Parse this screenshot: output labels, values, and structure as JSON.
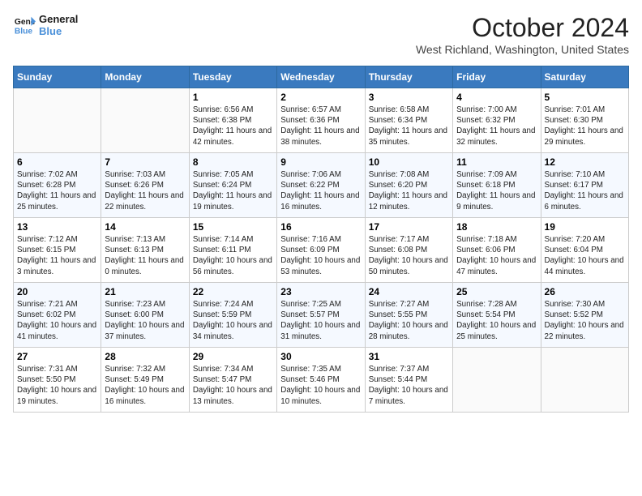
{
  "logo": {
    "line1": "General",
    "line2": "Blue"
  },
  "title": "October 2024",
  "location": "West Richland, Washington, United States",
  "weekdays": [
    "Sunday",
    "Monday",
    "Tuesday",
    "Wednesday",
    "Thursday",
    "Friday",
    "Saturday"
  ],
  "weeks": [
    [
      {
        "day": "",
        "text": ""
      },
      {
        "day": "",
        "text": ""
      },
      {
        "day": "1",
        "text": "Sunrise: 6:56 AM\nSunset: 6:38 PM\nDaylight: 11 hours and 42 minutes."
      },
      {
        "day": "2",
        "text": "Sunrise: 6:57 AM\nSunset: 6:36 PM\nDaylight: 11 hours and 38 minutes."
      },
      {
        "day": "3",
        "text": "Sunrise: 6:58 AM\nSunset: 6:34 PM\nDaylight: 11 hours and 35 minutes."
      },
      {
        "day": "4",
        "text": "Sunrise: 7:00 AM\nSunset: 6:32 PM\nDaylight: 11 hours and 32 minutes."
      },
      {
        "day": "5",
        "text": "Sunrise: 7:01 AM\nSunset: 6:30 PM\nDaylight: 11 hours and 29 minutes."
      }
    ],
    [
      {
        "day": "6",
        "text": "Sunrise: 7:02 AM\nSunset: 6:28 PM\nDaylight: 11 hours and 25 minutes."
      },
      {
        "day": "7",
        "text": "Sunrise: 7:03 AM\nSunset: 6:26 PM\nDaylight: 11 hours and 22 minutes."
      },
      {
        "day": "8",
        "text": "Sunrise: 7:05 AM\nSunset: 6:24 PM\nDaylight: 11 hours and 19 minutes."
      },
      {
        "day": "9",
        "text": "Sunrise: 7:06 AM\nSunset: 6:22 PM\nDaylight: 11 hours and 16 minutes."
      },
      {
        "day": "10",
        "text": "Sunrise: 7:08 AM\nSunset: 6:20 PM\nDaylight: 11 hours and 12 minutes."
      },
      {
        "day": "11",
        "text": "Sunrise: 7:09 AM\nSunset: 6:18 PM\nDaylight: 11 hours and 9 minutes."
      },
      {
        "day": "12",
        "text": "Sunrise: 7:10 AM\nSunset: 6:17 PM\nDaylight: 11 hours and 6 minutes."
      }
    ],
    [
      {
        "day": "13",
        "text": "Sunrise: 7:12 AM\nSunset: 6:15 PM\nDaylight: 11 hours and 3 minutes."
      },
      {
        "day": "14",
        "text": "Sunrise: 7:13 AM\nSunset: 6:13 PM\nDaylight: 11 hours and 0 minutes."
      },
      {
        "day": "15",
        "text": "Sunrise: 7:14 AM\nSunset: 6:11 PM\nDaylight: 10 hours and 56 minutes."
      },
      {
        "day": "16",
        "text": "Sunrise: 7:16 AM\nSunset: 6:09 PM\nDaylight: 10 hours and 53 minutes."
      },
      {
        "day": "17",
        "text": "Sunrise: 7:17 AM\nSunset: 6:08 PM\nDaylight: 10 hours and 50 minutes."
      },
      {
        "day": "18",
        "text": "Sunrise: 7:18 AM\nSunset: 6:06 PM\nDaylight: 10 hours and 47 minutes."
      },
      {
        "day": "19",
        "text": "Sunrise: 7:20 AM\nSunset: 6:04 PM\nDaylight: 10 hours and 44 minutes."
      }
    ],
    [
      {
        "day": "20",
        "text": "Sunrise: 7:21 AM\nSunset: 6:02 PM\nDaylight: 10 hours and 41 minutes."
      },
      {
        "day": "21",
        "text": "Sunrise: 7:23 AM\nSunset: 6:00 PM\nDaylight: 10 hours and 37 minutes."
      },
      {
        "day": "22",
        "text": "Sunrise: 7:24 AM\nSunset: 5:59 PM\nDaylight: 10 hours and 34 minutes."
      },
      {
        "day": "23",
        "text": "Sunrise: 7:25 AM\nSunset: 5:57 PM\nDaylight: 10 hours and 31 minutes."
      },
      {
        "day": "24",
        "text": "Sunrise: 7:27 AM\nSunset: 5:55 PM\nDaylight: 10 hours and 28 minutes."
      },
      {
        "day": "25",
        "text": "Sunrise: 7:28 AM\nSunset: 5:54 PM\nDaylight: 10 hours and 25 minutes."
      },
      {
        "day": "26",
        "text": "Sunrise: 7:30 AM\nSunset: 5:52 PM\nDaylight: 10 hours and 22 minutes."
      }
    ],
    [
      {
        "day": "27",
        "text": "Sunrise: 7:31 AM\nSunset: 5:50 PM\nDaylight: 10 hours and 19 minutes."
      },
      {
        "day": "28",
        "text": "Sunrise: 7:32 AM\nSunset: 5:49 PM\nDaylight: 10 hours and 16 minutes."
      },
      {
        "day": "29",
        "text": "Sunrise: 7:34 AM\nSunset: 5:47 PM\nDaylight: 10 hours and 13 minutes."
      },
      {
        "day": "30",
        "text": "Sunrise: 7:35 AM\nSunset: 5:46 PM\nDaylight: 10 hours and 10 minutes."
      },
      {
        "day": "31",
        "text": "Sunrise: 7:37 AM\nSunset: 5:44 PM\nDaylight: 10 hours and 7 minutes."
      },
      {
        "day": "",
        "text": ""
      },
      {
        "day": "",
        "text": ""
      }
    ]
  ]
}
